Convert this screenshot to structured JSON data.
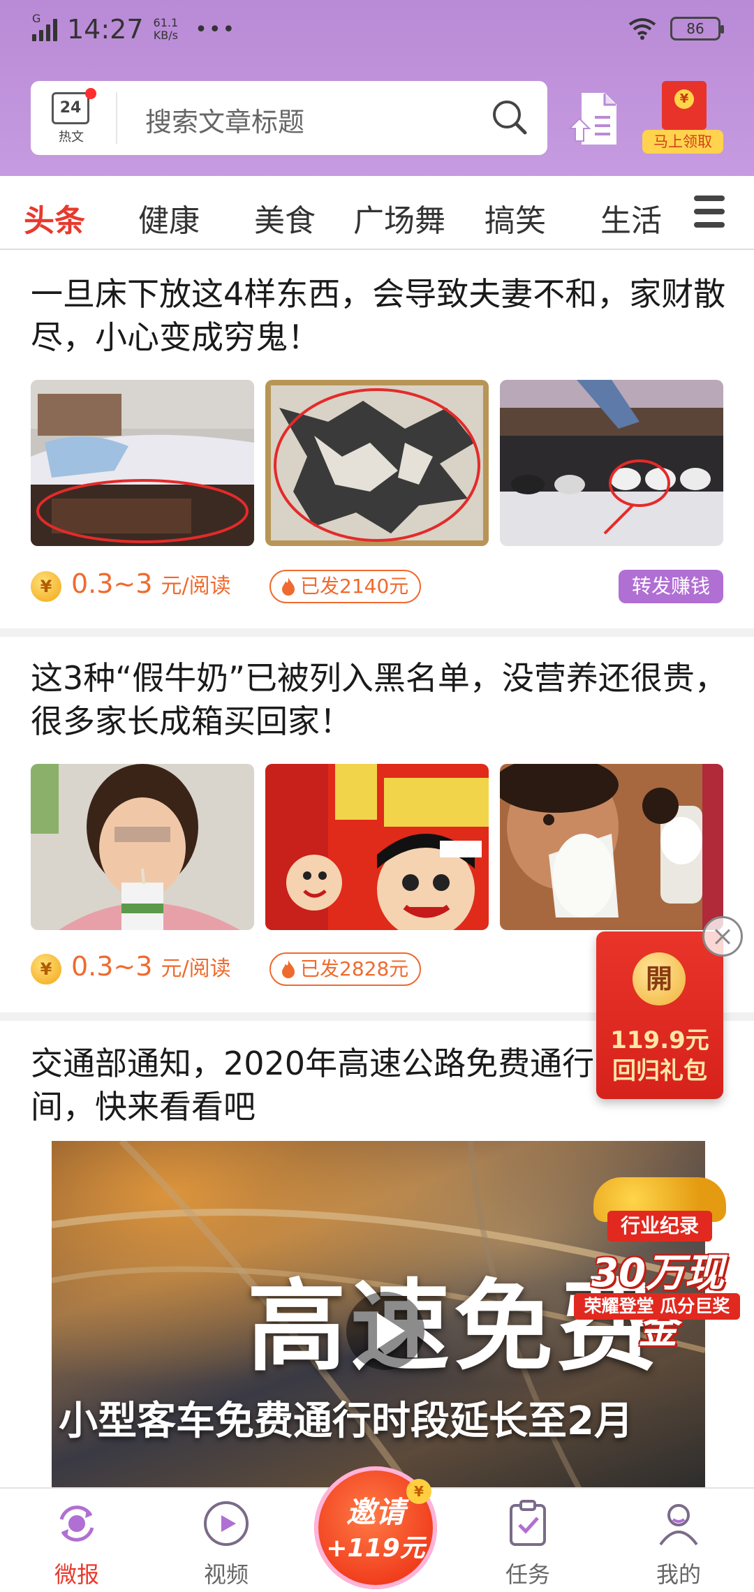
{
  "status_bar": {
    "network": "G",
    "time": "14:27",
    "speed_value": "61.1",
    "speed_unit": "KB/s",
    "more": "•••",
    "battery": "86"
  },
  "header": {
    "hot_date": "24",
    "hot_label": "热文",
    "search_placeholder": "搜索文章标题",
    "redpack_symbol": "¥",
    "redpack_label": "马上领取"
  },
  "tabs": [
    "头条",
    "健康",
    "美食",
    "广场舞",
    "搞笑",
    "生活"
  ],
  "articles": [
    {
      "title": "一旦床下放这4样东西，会导致夫妻不和，家财散尽，小心变成穷鬼！",
      "reward": "0.3~3",
      "reward_unit": "元/阅读",
      "sent": "已发2140元",
      "share": "转发赚钱"
    },
    {
      "title": "这3种“假牛奶”已被列入黑名单，没营养还很贵，很多家长成箱买回家！",
      "reward": "0.3~3",
      "reward_unit": "元/阅读",
      "sent": "已发2828元"
    },
    {
      "title": "交通部通知，2020年高速公路免费通行时间，快来看看吧",
      "video_headline": "高速免费",
      "video_caption": "小型客车免费通行时段延长至2月"
    }
  ],
  "coin_symbol": "¥",
  "float_packet": {
    "open": "開",
    "amount": "119.9元",
    "label": "回归礼包"
  },
  "promo": {
    "line1": "行业纪录",
    "line2": "30万现金",
    "line3": "荣耀登堂 瓜分巨奖"
  },
  "bottom_nav": {
    "items": [
      "微报",
      "视频",
      "任务",
      "我的"
    ],
    "invite_title": "邀请",
    "invite_amount": "+119元",
    "invite_coin": "¥"
  },
  "colors": {
    "header_purple": "#c69be0",
    "accent_red": "#e8392d",
    "reward_orange": "#ef6a2e",
    "share_purple": "#b06fd3"
  }
}
